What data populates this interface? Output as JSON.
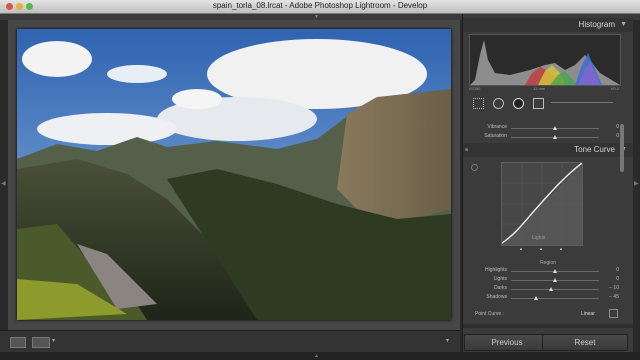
{
  "window": {
    "title": "spain_torla_08.lrcat - Adobe Photoshop Lightroom - Develop"
  },
  "histogram": {
    "title": "Histogram",
    "info_left": "ISO50",
    "info_mid": "12 mm",
    "info_right": "f/9.0"
  },
  "basic": {
    "sliders": [
      {
        "label": "Vibrance",
        "value": "0",
        "level": 0.5
      },
      {
        "label": "Saturation",
        "value": "0",
        "level": 0.5
      }
    ]
  },
  "tone_curve": {
    "title": "Tone Curve",
    "region_label": "Lights",
    "region_header": "Region",
    "sliders": [
      {
        "label": "Highlights",
        "value": "0",
        "level": 0.5
      },
      {
        "label": "Lights",
        "value": "0",
        "level": 0.5
      },
      {
        "label": "Darks",
        "value": "− 10",
        "level": 0.45
      },
      {
        "label": "Shadows",
        "value": "− 45",
        "level": 0.28
      }
    ],
    "point_curve_label": "Point Curve :",
    "point_curve_value": "Linear"
  },
  "footer": {
    "previous": "Previous",
    "reset": "Reset"
  },
  "colors": {
    "panel": "#3b3b3b",
    "center": "#474747",
    "text": "#cccccc"
  }
}
